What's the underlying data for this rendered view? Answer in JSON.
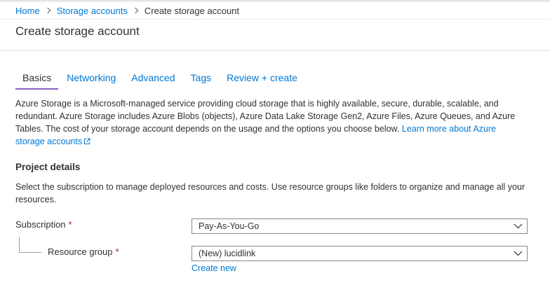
{
  "breadcrumb": {
    "home": "Home",
    "storage_accounts": "Storage accounts",
    "current": "Create storage account"
  },
  "page": {
    "title": "Create storage account"
  },
  "tabs": [
    {
      "label": "Basics",
      "active": true
    },
    {
      "label": "Networking",
      "active": false
    },
    {
      "label": "Advanced",
      "active": false
    },
    {
      "label": "Tags",
      "active": false
    },
    {
      "label": "Review + create",
      "active": false
    }
  ],
  "intro": {
    "text": "Azure Storage is a Microsoft-managed service providing cloud storage that is highly available, secure, durable, scalable, and redundant. Azure Storage includes Azure Blobs (objects), Azure Data Lake Storage Gen2, Azure Files, Azure Queues, and Azure Tables. The cost of your storage account depends on the usage and the options you choose below.",
    "link_text": "Learn more about Azure storage accounts"
  },
  "project_details": {
    "title": "Project details",
    "description": "Select the subscription to manage deployed resources and costs. Use resource groups like folders to organize and manage all your resources.",
    "subscription": {
      "label": "Subscription",
      "required_marker": "*",
      "value": "Pay-As-You-Go"
    },
    "resource_group": {
      "label": "Resource group",
      "required_marker": "*",
      "value": "(New) lucidlink",
      "create_new": "Create new"
    }
  },
  "colors": {
    "link": "#0078d4",
    "active_tab_underline": "#8661c5",
    "required": "#a4262c",
    "text": "#323130"
  }
}
